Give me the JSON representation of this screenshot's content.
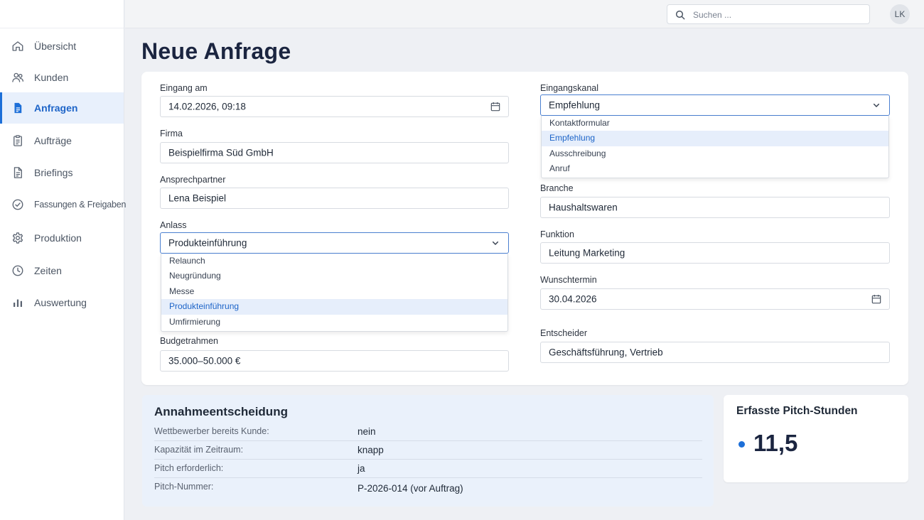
{
  "search": {
    "placeholder": "Suchen ..."
  },
  "user": {
    "initials": "LK"
  },
  "sidebar": {
    "items": [
      {
        "label": "Übersicht",
        "icon": "home-icon"
      },
      {
        "label": "Kunden",
        "icon": "users-icon"
      },
      {
        "label": "Anfragen",
        "icon": "document-icon",
        "active": true
      },
      {
        "label": "Aufträge",
        "icon": "clipboard-icon"
      },
      {
        "label": "Briefings",
        "icon": "file-text-icon"
      },
      {
        "label": "Fassungen & Freigaben",
        "icon": "check-circle-icon"
      },
      {
        "label": "Produktion",
        "icon": "gear-icon"
      },
      {
        "label": "Zeiten",
        "icon": "clock-icon"
      },
      {
        "label": "Auswertung",
        "icon": "bar-chart-icon"
      }
    ]
  },
  "page": {
    "title": "Neue Anfrage"
  },
  "form": {
    "eingang": {
      "label": "Eingang am",
      "value": "14.02.2026, 09:18"
    },
    "firma": {
      "label": "Firma",
      "value": "Beispielfirma Süd GmbH"
    },
    "ansprechpartner": {
      "label": "Ansprechpartner",
      "value": "Lena Beispiel"
    },
    "anlass": {
      "label": "Anlass",
      "value": "Produkteinführung",
      "options": [
        "Relaunch",
        "Neugründung",
        "Messe",
        "Produkteinführung",
        "Umfirmierung"
      ]
    },
    "budget": {
      "label": "Budgetrahmen",
      "value": "35.000–50.000 €"
    },
    "kanal": {
      "label": "Eingangskanal",
      "value": "Empfehlung",
      "options": [
        "Kontaktformular",
        "Empfehlung",
        "Ausschreibung",
        "Anruf"
      ]
    },
    "branche": {
      "label": "Branche",
      "value": "Haushaltswaren"
    },
    "funktion": {
      "label": "Funktion",
      "value": "Leitung Marketing"
    },
    "wunschtermin": {
      "label": "Wunschtermin",
      "value": "30.04.2026"
    },
    "entscheider": {
      "label": "Entscheider",
      "value": "Geschäftsführung, Vertrieb"
    }
  },
  "decision": {
    "title": "Annahmeentscheidung",
    "rows": [
      {
        "key": "Wettbewerber bereits Kunde:",
        "value": "nein"
      },
      {
        "key": "Kapazität im Zeitraum:",
        "value": "knapp"
      },
      {
        "key": "Pitch erforderlich:",
        "value": "ja"
      },
      {
        "key": "Pitch-Nummer:",
        "value": "P-2026-014 (vor Auftrag)"
      }
    ]
  },
  "pitch": {
    "title": "Erfasste Pitch-Stunden",
    "hours": "11,5"
  },
  "colors": {
    "accent": "#1d6fd8",
    "active_bg": "#e8f0fc",
    "decision_bg": "#eaf1fb"
  }
}
